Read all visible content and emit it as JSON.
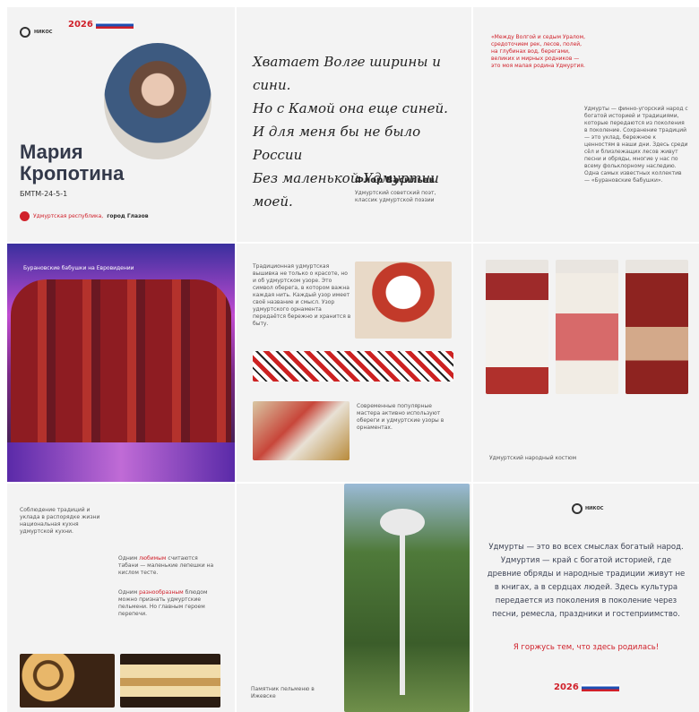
{
  "profile": {
    "first_name": "Мария",
    "last_name": "Кропотина",
    "group": "БМТМ-24-5-1",
    "region": "Удмуртская республика,",
    "city": "город Глазов",
    "year": "2026"
  },
  "poem": {
    "lines": [
      "Хватает Волге ширины и сини.",
      "Но с Камой она еще синей.",
      "И для меня бы не было России",
      "Без маленькой Удмуртии моей."
    ],
    "author": "Флор Васильев",
    "author_desc": "Удмуртский советский поэт, классик удмуртской поэзии"
  },
  "quote": {
    "text": "«Между Волгой и седым Уралом, средоточием рек, лесов, полей, на глубинах вод, берегами, великих и мирных родников — это моя малая родина Удмуртия.",
    "description": "Удмурты — финно-угорский народ с богатой историей и традициями, которые передаются из поколения в поколение. Сохранение традиций — это уклад, бережное к ценностям в наши дни. Здесь среди сёл и близлежащих лесов живут песни и обряды, многие у нас по всему фольклорному наследию. Одна самых известных коллектив — «Бурановские бабушки»."
  },
  "buranovo": {
    "caption": "Бурановские бабушки на Евровидении"
  },
  "ornament": {
    "text1": "Традиционная удмуртская вышивка не только о красоте, но и об удмуртском узоре. Это символ оберега, в котором важна каждая нить. Каждый узор имеет своё название и смысл. Узор удмуртского орнамента передаётся бережно и хранится в быту.",
    "text2": "Современные популярные мастера активно используют обереги и удмуртские узоры в орнаментах."
  },
  "costume": {
    "caption": "Удмуртский народный костюм"
  },
  "food": {
    "intro": "Соблюдение традиций и уклада в распорядке жизни национальная кухня удмуртской кухни.",
    "p1_prefix": "Одним ",
    "p1_highlight": "любимым",
    "p1_suffix": " считаются табани — маленькие лепешки на кислом тесте.",
    "p2_prefix": "Одним ",
    "p2_highlight": "разнообразным",
    "p2_suffix": " блюдом можно признать удмуртские пельмени. Но главным героем перепечи."
  },
  "monument": {
    "caption": "Памятник пельменю в Ижевске"
  },
  "closing": {
    "text": "Удмурты — это во всех смыслах богатый народ. Удмуртия — край с богатой историей, где древние обряды и народные традиции живут не в книгах, а в сердцах людей. Здесь культура передается из поколения в поколение через песни, ремесла, праздники и гостеприимство.",
    "highlight": "Я горжусь тем, что здесь родилась!",
    "year": "2026"
  },
  "colors": {
    "accent": "#d0202a",
    "text": "#33394a"
  }
}
